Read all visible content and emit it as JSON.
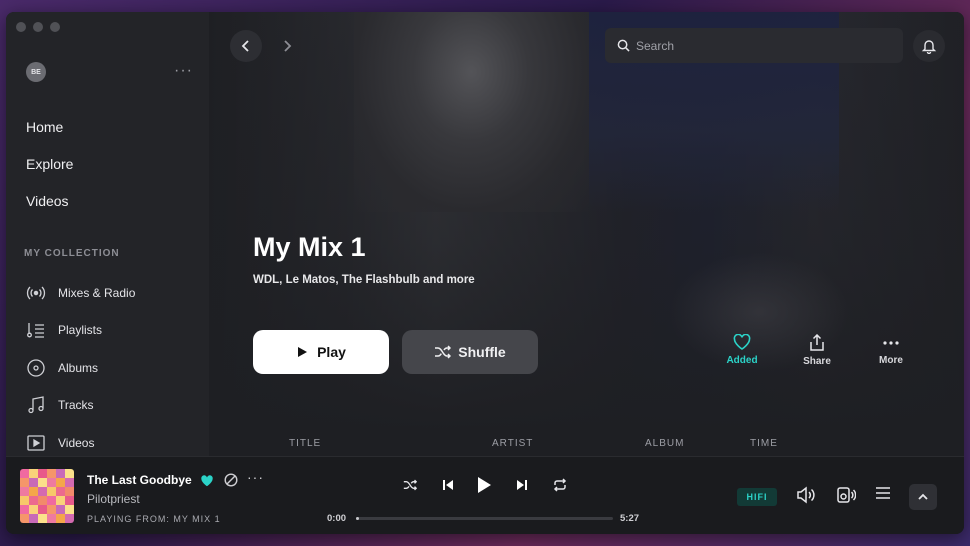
{
  "user": {
    "avatar_initials": "BE"
  },
  "sidebar": {
    "nav": [
      {
        "label": "Home"
      },
      {
        "label": "Explore"
      },
      {
        "label": "Videos"
      }
    ],
    "collection_title": "MY COLLECTION",
    "collection": [
      {
        "label": "Mixes & Radio",
        "icon": "radio-icon"
      },
      {
        "label": "Playlists",
        "icon": "playlist-icon"
      },
      {
        "label": "Albums",
        "icon": "album-icon"
      },
      {
        "label": "Tracks",
        "icon": "music-note-icon"
      },
      {
        "label": "Videos",
        "icon": "video-icon"
      }
    ]
  },
  "search": {
    "placeholder": "Search"
  },
  "mix": {
    "title": "My Mix 1",
    "subtitle": "WDL, Le Matos, The Flashbulb and more",
    "play_label": "Play",
    "shuffle_label": "Shuffle",
    "actions": {
      "added": "Added",
      "share": "Share",
      "more": "More"
    }
  },
  "table": {
    "columns": [
      "TITLE",
      "ARTIST",
      "ALBUM",
      "TIME"
    ]
  },
  "player": {
    "track_title": "The Last Goodbye",
    "artist": "Pilotpriest",
    "playing_from": "PLAYING FROM: MY MIX 1",
    "elapsed": "0:00",
    "duration": "5:27",
    "progress": 0.01,
    "quality_badge": "HIFI"
  },
  "colors": {
    "accent": "#2bd3c8",
    "window_bg": "#1b1c1f",
    "sidebar_bg": "#232428"
  }
}
